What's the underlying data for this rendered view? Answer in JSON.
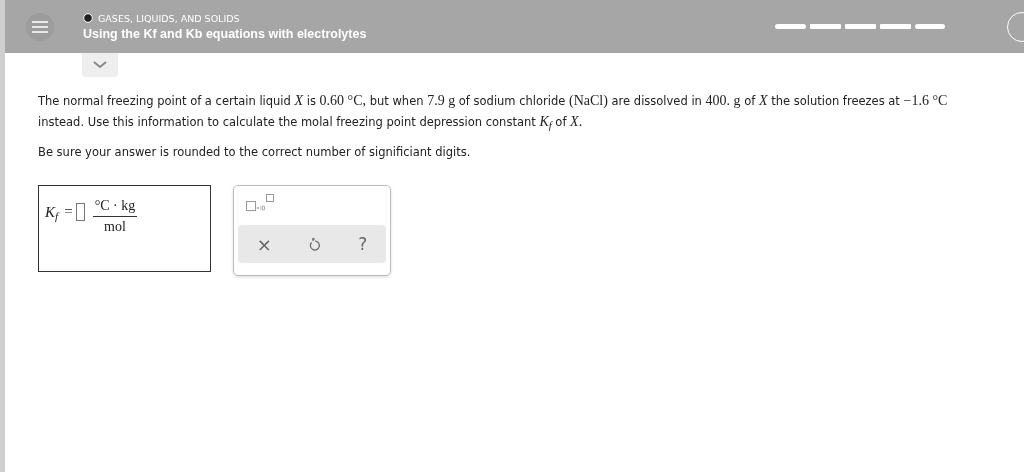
{
  "header": {
    "topic": "GASES, LIQUIDS, AND SOLIDS",
    "title": "Using the Kf and Kb equations with electrolytes"
  },
  "question": {
    "lines": [
      [
        {
          "kind": "text",
          "text": "The normal freezing point of a certain liquid "
        },
        {
          "kind": "math",
          "text": "*X*"
        },
        {
          "kind": "text",
          "text": " is "
        },
        {
          "kind": "math",
          "text": "0.60 °C,"
        },
        {
          "kind": "text",
          "text": " but when "
        },
        {
          "kind": "math",
          "text": "7.9 g"
        },
        {
          "kind": "text",
          "text": " of sodium chloride "
        },
        {
          "kind": "math",
          "text": "(NaCl)"
        },
        {
          "kind": "text",
          "text": " are dissolved in "
        },
        {
          "kind": "math",
          "text": "400. g"
        },
        {
          "kind": "text",
          "text": " of "
        },
        {
          "kind": "math",
          "text": "*X*"
        },
        {
          "kind": "text",
          "text": " the solution freezes at "
        },
        {
          "kind": "math",
          "text": "−1.6 °C"
        }
      ],
      [
        {
          "kind": "text",
          "text": "instead. Use this information to calculate the molal freezing point depression constant "
        },
        {
          "kind": "symbol",
          "text": "K$_{f}$"
        },
        {
          "kind": "text",
          "text": " of "
        },
        {
          "kind": "math",
          "text": "*X*."
        }
      ]
    ],
    "note": "Be sure your answer is rounded to the correct number of significiant digits."
  },
  "answer": {
    "symbol": "K$_{f}$",
    "equals": "=",
    "unit_numerator": "°C · kg",
    "unit_denominator": "mol"
  },
  "tools": {
    "buttons": [
      {
        "kind": "clear",
        "label": "×"
      },
      {
        "kind": "undo"
      },
      {
        "kind": "help",
        "label": "?"
      }
    ]
  }
}
